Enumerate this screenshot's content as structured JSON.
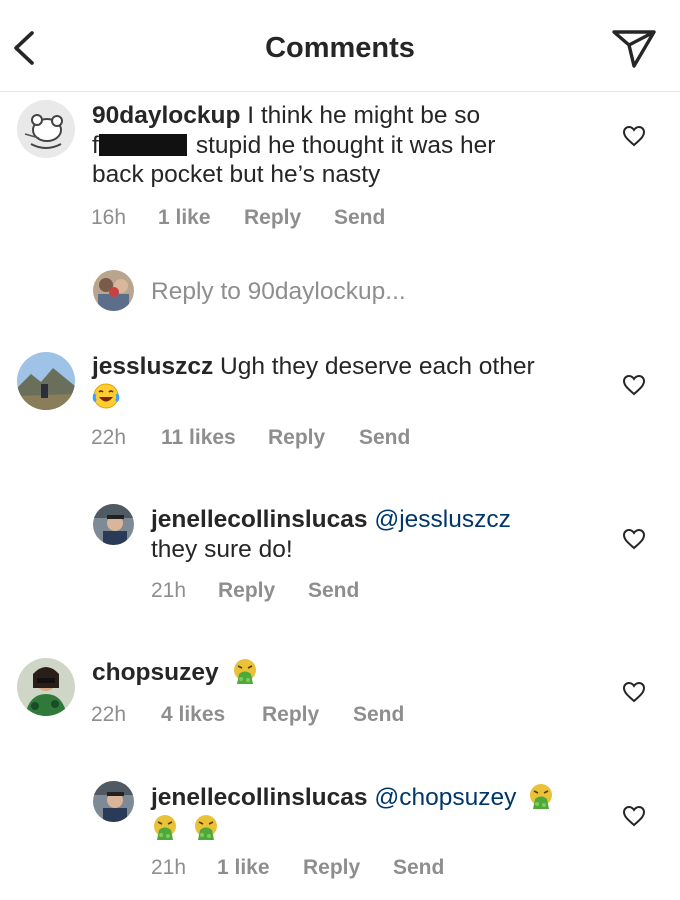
{
  "header": {
    "title": "Comments"
  },
  "comments": [
    {
      "username": "90daylockup",
      "text_line1": "I think he might be so",
      "text_prefix": "f",
      "text_line2_rest": "stupid he thought it was her",
      "text_line3": "back pocket but he’s nasty",
      "time": "16h",
      "likes": "1 like",
      "reply": "Reply",
      "send": "Send"
    },
    {
      "username": "jessluszcz",
      "text": "Ugh they deserve each other",
      "emoji": "joy-emoji",
      "time": "22h",
      "likes": "11 likes",
      "reply": "Reply",
      "send": "Send"
    },
    {
      "username": "jenellecollinslucas",
      "mention": "@jessluszcz",
      "text": "they sure do!",
      "time": "21h",
      "reply": "Reply",
      "send": "Send"
    },
    {
      "username": "chopsuzey",
      "emoji": "vomiting-face-emoji",
      "time": "22h",
      "likes": "4 likes",
      "reply": "Reply",
      "send": "Send"
    },
    {
      "username": "jenellecollinslucas",
      "mention": "@chopsuzey",
      "emoji": "vomiting-face-emoji",
      "time": "21h",
      "likes": "1 like",
      "reply": "Reply",
      "send": "Send"
    }
  ],
  "reply_composer": {
    "placeholder": "Reply to 90daylockup..."
  },
  "colors": {
    "text": "#262626",
    "muted": "#8e8e8e",
    "mention": "#00376b",
    "divider": "#e6e6e6"
  }
}
